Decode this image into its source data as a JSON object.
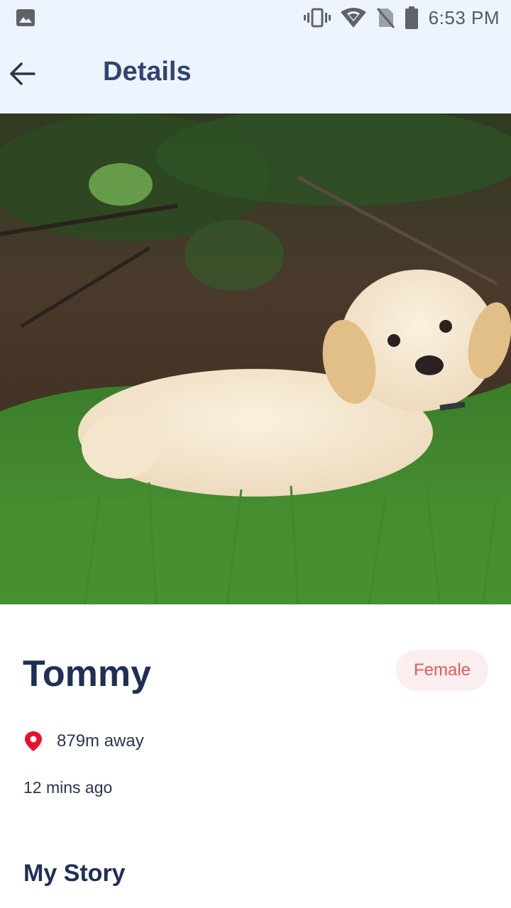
{
  "status_bar": {
    "time": "6:53 PM",
    "icons": [
      "image-icon",
      "vibrate-icon",
      "wifi-icon",
      "no-sim-icon",
      "battery-icon"
    ]
  },
  "app_bar": {
    "title": "Details",
    "back_icon": "arrow-left-icon"
  },
  "pet": {
    "name": "Tommy",
    "gender": "Female",
    "distance": "879m away",
    "posted": "12 mins ago"
  },
  "sections": {
    "story_title": "My Story"
  },
  "colors": {
    "app_bar_bg": "#eef4fd",
    "title": "#2f4470",
    "name": "#1f2f55",
    "badge_bg": "#fbeeee",
    "badge_text": "#e25b57",
    "pin": "#e8102a"
  }
}
